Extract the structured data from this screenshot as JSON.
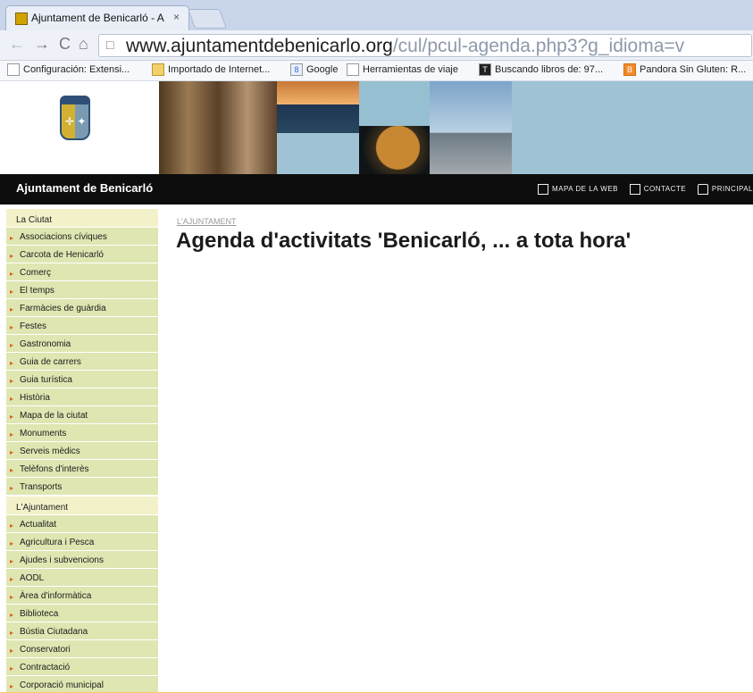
{
  "browser": {
    "tab": {
      "title": "Ajuntament de Benicarló - A",
      "close": "×"
    },
    "address": {
      "host": "www.ajuntamentdebenicarlo.org",
      "path": "/cul/pcul-agenda.php3?g_idioma=v"
    },
    "bookmarks": [
      {
        "label": "Configuración: Extensi...",
        "icon": "page"
      },
      {
        "label": "Importado de Internet...",
        "icon": "folder"
      },
      {
        "label": "Google",
        "icon": "google"
      },
      {
        "label": "Herramientas de viaje",
        "icon": "page"
      },
      {
        "label": "Buscando libros de: 97...",
        "icon": "t"
      },
      {
        "label": "Pandora Sin Gluten: R...",
        "icon": "b"
      }
    ]
  },
  "site": {
    "title": "Ajuntament de Benicarló",
    "header_links": [
      "MAPA DE LA WEB",
      "CONTACTE",
      "PRINCIPAL"
    ],
    "breadcrumb": "L'AJUNTAMENT",
    "heading": "Agenda d'activitats 'Benicarló, ... a tota hora'"
  },
  "sidebar": {
    "sections": [
      {
        "title": "La Ciutat",
        "items": [
          "Associacions cíviques",
          "Carcota de Henicarló",
          "Comerç",
          "El temps",
          "Farmàcies de guàrdia",
          "Festes",
          "Gastronomia",
          "Guia de carrers",
          "Guia turística",
          "Història",
          "Mapa de la ciutat",
          "Monuments",
          "Serveis mèdics",
          "Telèfons d'interès",
          "Transports"
        ]
      },
      {
        "title": "L'Ajuntament",
        "items": [
          "Actualitat",
          "Agricultura i Pesca",
          "Ajudes i subvencions",
          "AODL",
          "Àrea d'informàtica",
          "Biblioteca",
          "Bústia Ciutadana",
          "Conservatori",
          "Contractació",
          "Corporació municipal"
        ]
      }
    ]
  }
}
